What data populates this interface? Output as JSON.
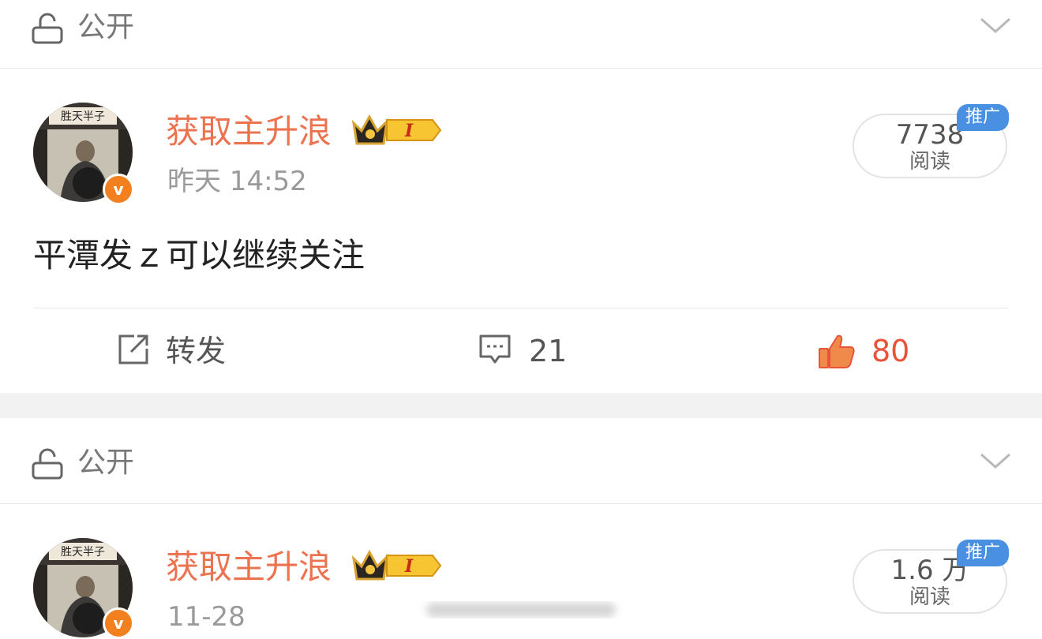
{
  "posts": [
    {
      "visibility_label": "公开",
      "username": "获取主升浪",
      "badge_level": "I",
      "time": "昨天 14:52",
      "read_count": "7738",
      "read_label": "阅读",
      "promo_label": "推广",
      "content": "平潭发ｚ可以继续关注",
      "actions": {
        "repost_label": "转发",
        "comment_count": "21",
        "like_count": "80"
      }
    },
    {
      "visibility_label": "公开",
      "username": "获取主升浪",
      "badge_level": "I",
      "time": "11-28",
      "read_count": "1.6 万",
      "read_label": "阅读",
      "promo_label": "推广"
    }
  ],
  "colors": {
    "username": "#eb7350",
    "like_active": "#e8533a",
    "promo_badge": "#4a90e2",
    "verified_badge": "#f3801e",
    "separator": "#f2f2f2"
  },
  "icons": {
    "visibility": "unlock-icon",
    "collapse": "chevron-down-icon",
    "verified": "verified-v-icon",
    "member": "crown-badge-icon",
    "repost": "repost-icon",
    "comment": "comment-icon",
    "like": "thumbs-up-icon"
  }
}
